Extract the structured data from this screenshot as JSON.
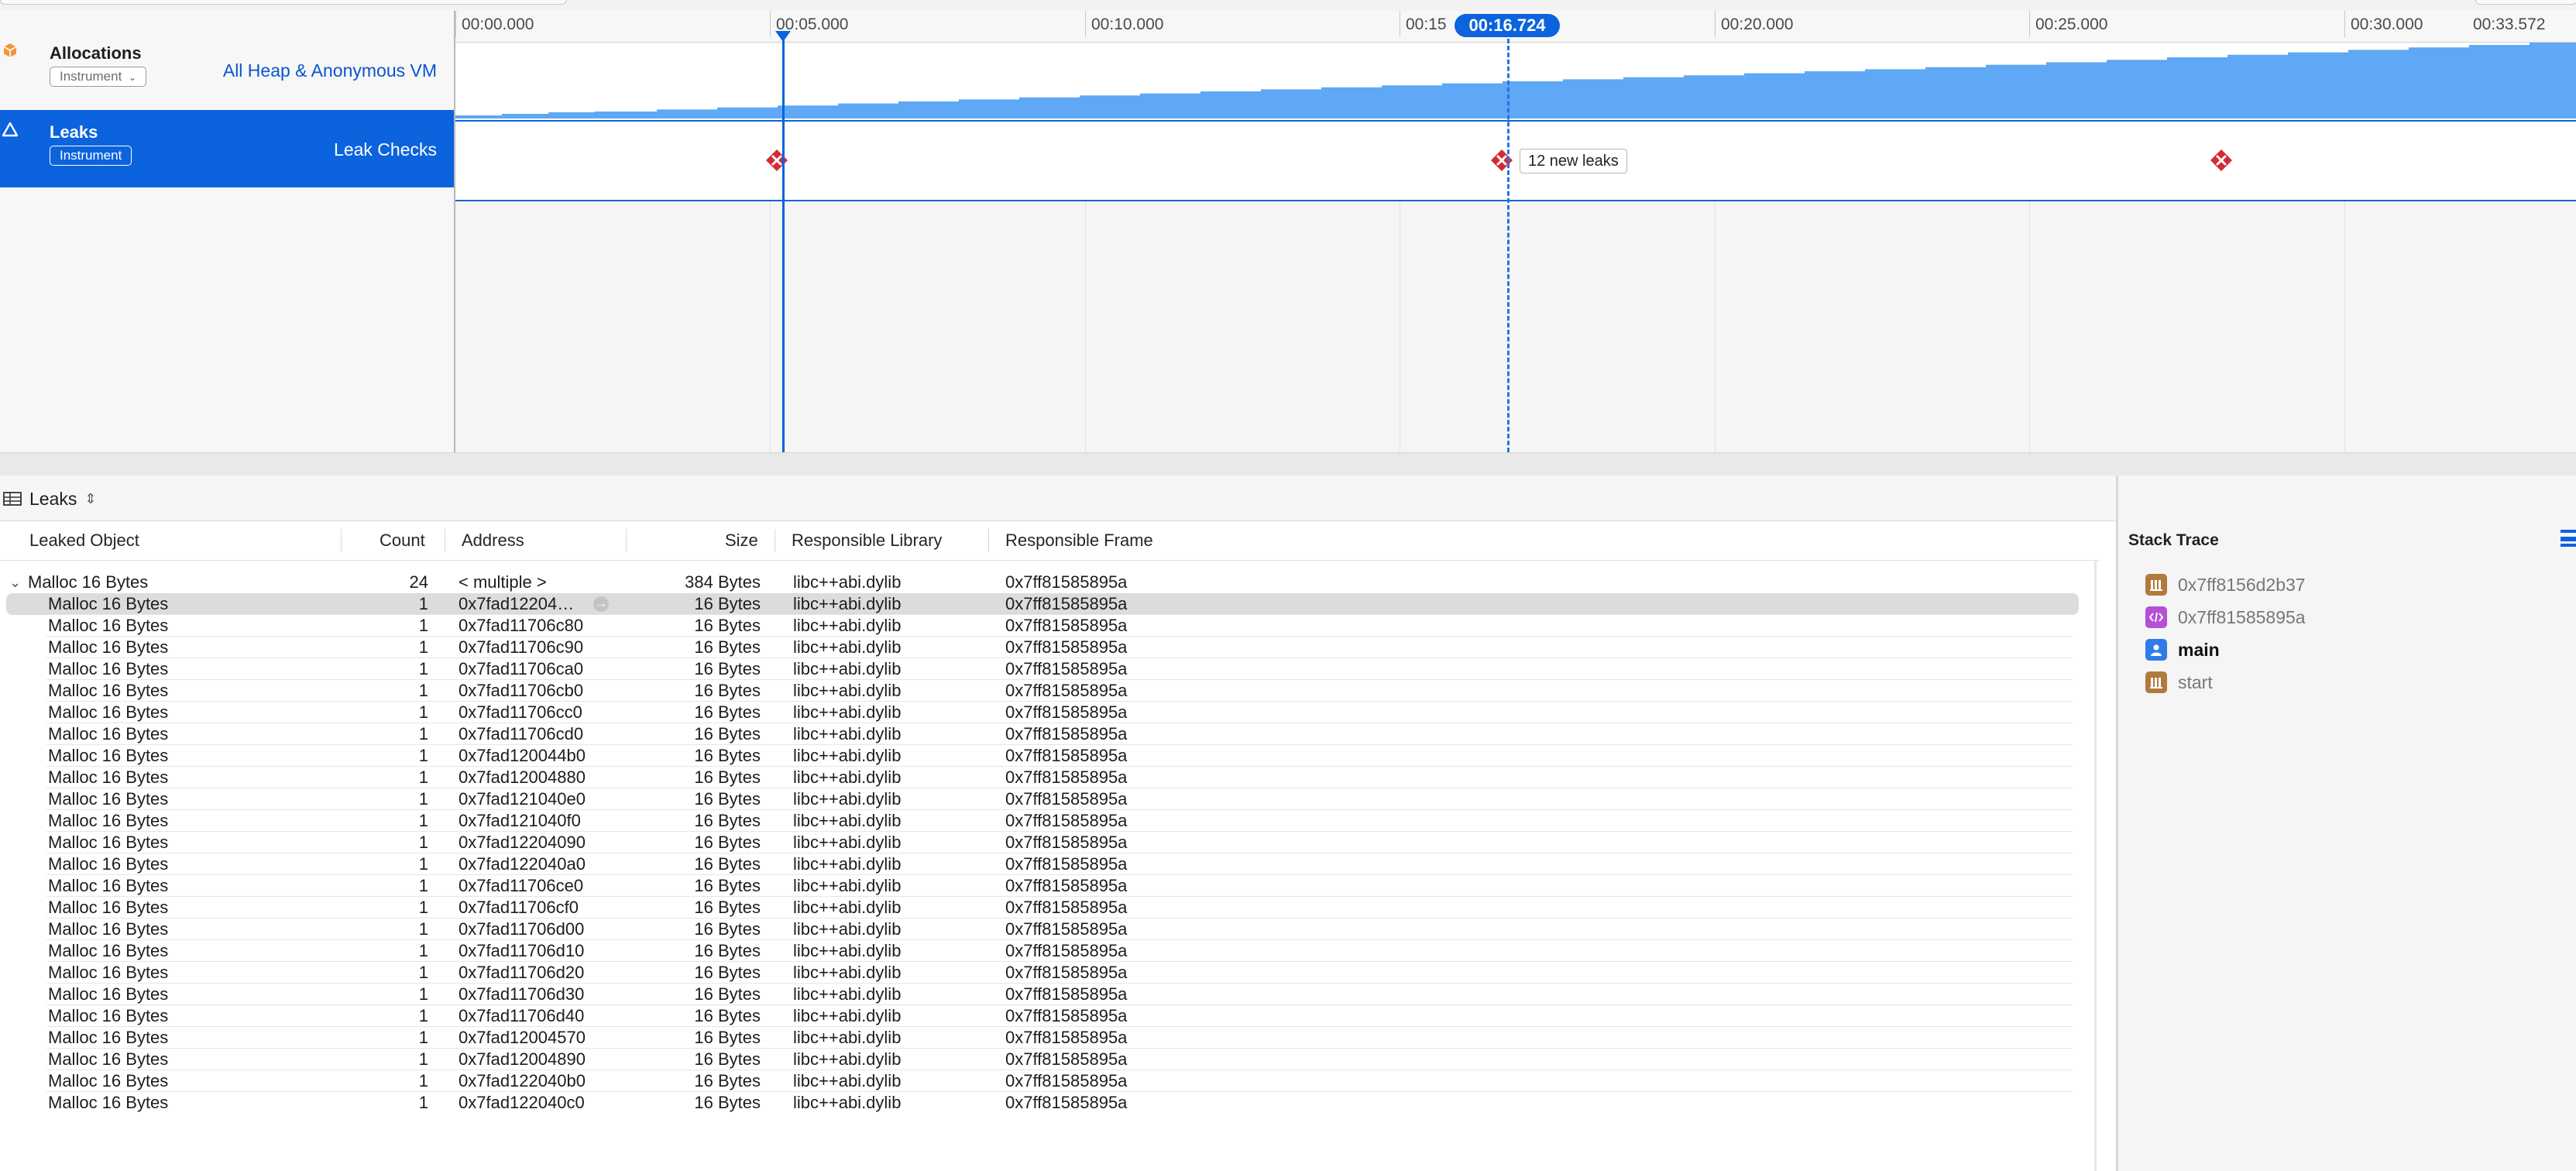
{
  "colors": {
    "accent": "#0b63de",
    "allocation_graph": "#5ea8f5",
    "leak_marker": "#d42a35",
    "selection": "#dcdcdc"
  },
  "tracks": {
    "allocations": {
      "name": "Allocations",
      "badge": "Instrument",
      "detail": "All Heap & Anonymous VM",
      "icon": "allocations-instrument-icon"
    },
    "leaks": {
      "name": "Leaks",
      "badge": "Instrument",
      "detail": "Leak Checks",
      "icon": "leaks-instrument-icon"
    }
  },
  "ruler": {
    "ticks": [
      "00:00.000",
      "00:05.000",
      "00:10.000",
      "00:15",
      "00:20.000",
      "00:25.000",
      "00:30.000"
    ],
    "end_time": "00:33.572",
    "cursor_time": "00:16.724"
  },
  "leak_checks": {
    "tooltip": "12 new leaks"
  },
  "navbar": {
    "view_label": "Leaks"
  },
  "table": {
    "columns": [
      "Leaked Object",
      "Count",
      "Address",
      "Size",
      "Responsible Library",
      "Responsible Frame"
    ],
    "group": {
      "object": "Malloc 16 Bytes",
      "count": "24",
      "address": "< multiple >",
      "size": "384 Bytes",
      "library": "libc++abi.dylib",
      "frame": "0x7ff81585895a"
    },
    "rows": [
      {
        "object": "Malloc 16 Bytes",
        "count": "1",
        "address": "0x7fad12204…",
        "size": "16 Bytes",
        "library": "libc++abi.dylib",
        "frame": "0x7ff81585895a"
      },
      {
        "object": "Malloc 16 Bytes",
        "count": "1",
        "address": "0x7fad11706c80",
        "size": "16 Bytes",
        "library": "libc++abi.dylib",
        "frame": "0x7ff81585895a"
      },
      {
        "object": "Malloc 16 Bytes",
        "count": "1",
        "address": "0x7fad11706c90",
        "size": "16 Bytes",
        "library": "libc++abi.dylib",
        "frame": "0x7ff81585895a"
      },
      {
        "object": "Malloc 16 Bytes",
        "count": "1",
        "address": "0x7fad11706ca0",
        "size": "16 Bytes",
        "library": "libc++abi.dylib",
        "frame": "0x7ff81585895a"
      },
      {
        "object": "Malloc 16 Bytes",
        "count": "1",
        "address": "0x7fad11706cb0",
        "size": "16 Bytes",
        "library": "libc++abi.dylib",
        "frame": "0x7ff81585895a"
      },
      {
        "object": "Malloc 16 Bytes",
        "count": "1",
        "address": "0x7fad11706cc0",
        "size": "16 Bytes",
        "library": "libc++abi.dylib",
        "frame": "0x7ff81585895a"
      },
      {
        "object": "Malloc 16 Bytes",
        "count": "1",
        "address": "0x7fad11706cd0",
        "size": "16 Bytes",
        "library": "libc++abi.dylib",
        "frame": "0x7ff81585895a"
      },
      {
        "object": "Malloc 16 Bytes",
        "count": "1",
        "address": "0x7fad120044b0",
        "size": "16 Bytes",
        "library": "libc++abi.dylib",
        "frame": "0x7ff81585895a"
      },
      {
        "object": "Malloc 16 Bytes",
        "count": "1",
        "address": "0x7fad12004880",
        "size": "16 Bytes",
        "library": "libc++abi.dylib",
        "frame": "0x7ff81585895a"
      },
      {
        "object": "Malloc 16 Bytes",
        "count": "1",
        "address": "0x7fad121040e0",
        "size": "16 Bytes",
        "library": "libc++abi.dylib",
        "frame": "0x7ff81585895a"
      },
      {
        "object": "Malloc 16 Bytes",
        "count": "1",
        "address": "0x7fad121040f0",
        "size": "16 Bytes",
        "library": "libc++abi.dylib",
        "frame": "0x7ff81585895a"
      },
      {
        "object": "Malloc 16 Bytes",
        "count": "1",
        "address": "0x7fad12204090",
        "size": "16 Bytes",
        "library": "libc++abi.dylib",
        "frame": "0x7ff81585895a"
      },
      {
        "object": "Malloc 16 Bytes",
        "count": "1",
        "address": "0x7fad122040a0",
        "size": "16 Bytes",
        "library": "libc++abi.dylib",
        "frame": "0x7ff81585895a"
      },
      {
        "object": "Malloc 16 Bytes",
        "count": "1",
        "address": "0x7fad11706ce0",
        "size": "16 Bytes",
        "library": "libc++abi.dylib",
        "frame": "0x7ff81585895a"
      },
      {
        "object": "Malloc 16 Bytes",
        "count": "1",
        "address": "0x7fad11706cf0",
        "size": "16 Bytes",
        "library": "libc++abi.dylib",
        "frame": "0x7ff81585895a"
      },
      {
        "object": "Malloc 16 Bytes",
        "count": "1",
        "address": "0x7fad11706d00",
        "size": "16 Bytes",
        "library": "libc++abi.dylib",
        "frame": "0x7ff81585895a"
      },
      {
        "object": "Malloc 16 Bytes",
        "count": "1",
        "address": "0x7fad11706d10",
        "size": "16 Bytes",
        "library": "libc++abi.dylib",
        "frame": "0x7ff81585895a"
      },
      {
        "object": "Malloc 16 Bytes",
        "count": "1",
        "address": "0x7fad11706d20",
        "size": "16 Bytes",
        "library": "libc++abi.dylib",
        "frame": "0x7ff81585895a"
      },
      {
        "object": "Malloc 16 Bytes",
        "count": "1",
        "address": "0x7fad11706d30",
        "size": "16 Bytes",
        "library": "libc++abi.dylib",
        "frame": "0x7ff81585895a"
      },
      {
        "object": "Malloc 16 Bytes",
        "count": "1",
        "address": "0x7fad11706d40",
        "size": "16 Bytes",
        "library": "libc++abi.dylib",
        "frame": "0x7ff81585895a"
      },
      {
        "object": "Malloc 16 Bytes",
        "count": "1",
        "address": "0x7fad12004570",
        "size": "16 Bytes",
        "library": "libc++abi.dylib",
        "frame": "0x7ff81585895a"
      },
      {
        "object": "Malloc 16 Bytes",
        "count": "1",
        "address": "0x7fad12004890",
        "size": "16 Bytes",
        "library": "libc++abi.dylib",
        "frame": "0x7ff81585895a"
      },
      {
        "object": "Malloc 16 Bytes",
        "count": "1",
        "address": "0x7fad122040b0",
        "size": "16 Bytes",
        "library": "libc++abi.dylib",
        "frame": "0x7ff81585895a"
      },
      {
        "object": "Malloc 16 Bytes",
        "count": "1",
        "address": "0x7fad122040c0",
        "size": "16 Bytes",
        "library": "libc++abi.dylib",
        "frame": "0x7ff81585895a"
      }
    ]
  },
  "stack_trace": {
    "title": "Stack Trace",
    "frames": [
      {
        "label": "0x7ff8156d2b37",
        "icon": "library-icon"
      },
      {
        "label": "0x7ff81585895a",
        "icon": "code-icon"
      },
      {
        "label": "main",
        "icon": "user-code-icon"
      },
      {
        "label": "start",
        "icon": "library-icon"
      }
    ]
  }
}
